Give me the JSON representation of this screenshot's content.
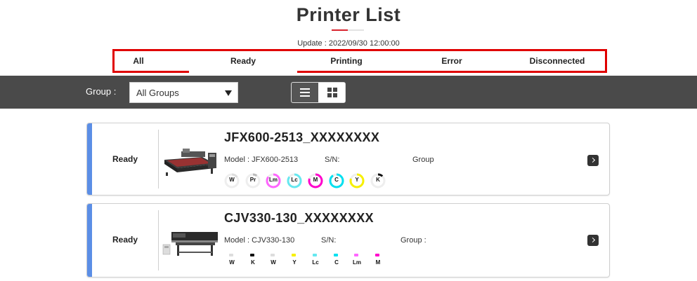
{
  "page": {
    "title": "Printer List",
    "update": "Update : 2022/09/30 12:00:00"
  },
  "tabs": [
    {
      "label": "All"
    },
    {
      "label": "Ready"
    },
    {
      "label": "Printing"
    },
    {
      "label": "Error"
    },
    {
      "label": "Disconnected"
    }
  ],
  "toolbar": {
    "group_label": "Group :",
    "group_selected": "All Groups",
    "views": [
      {
        "icon": "list-view-icon"
      },
      {
        "icon": "grid-view-icon"
      }
    ]
  },
  "printers": [
    {
      "status": "Ready",
      "name": "JFX600-2513_XXXXXXXX",
      "model": "Model : JFX600-2513",
      "sn": "S/N:",
      "group": "Group",
      "ink_style": "ring",
      "inks": [
        {
          "label": "W",
          "color": "#dddddd",
          "level": 0.15
        },
        {
          "label": "Pr",
          "color": "#bbbbbb",
          "level": 0.1
        },
        {
          "label": "Lm",
          "color": "#ff66ff",
          "level": 0.85
        },
        {
          "label": "Lc",
          "color": "#66e8f0",
          "level": 0.85
        },
        {
          "label": "M",
          "color": "#ff00cc",
          "level": 0.8
        },
        {
          "label": "C",
          "color": "#00e0f0",
          "level": 0.9
        },
        {
          "label": "Y",
          "color": "#f7f000",
          "level": 0.8
        },
        {
          "label": "K",
          "color": "#111111",
          "level": 0.12
        }
      ]
    },
    {
      "status": "Ready",
      "name": "CJV330-130_XXXXXXXX",
      "model": "Model : CJV330-130",
      "sn": "S/N:",
      "group": "Group :",
      "ink_style": "drop",
      "inks": [
        {
          "label": "W",
          "color": "#dddddd"
        },
        {
          "label": "K",
          "color": "#111111"
        },
        {
          "label": "W",
          "color": "#dddddd"
        },
        {
          "label": "Y",
          "color": "#f7f000"
        },
        {
          "label": "Lc",
          "color": "#66e8f0"
        },
        {
          "label": "C",
          "color": "#00e0f0"
        },
        {
          "label": "Lm",
          "color": "#ff66ff"
        },
        {
          "label": "M",
          "color": "#ff00cc"
        }
      ]
    }
  ],
  "colors": {
    "accent_red": "#e00000",
    "status_bar": "#5b8ee6",
    "toolbar_bg": "#4a4a4a"
  }
}
